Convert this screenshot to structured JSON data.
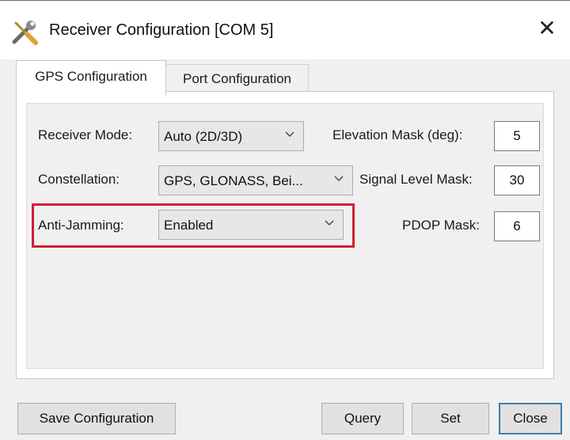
{
  "window": {
    "title": "Receiver Configuration [COM 5]",
    "close_glyph": "✕"
  },
  "tabs": [
    {
      "label": "GPS Configuration",
      "active": true
    },
    {
      "label": "Port Configuration",
      "active": false
    }
  ],
  "gps": {
    "receiver_mode": {
      "label": "Receiver Mode:",
      "value": "Auto (2D/3D)"
    },
    "constellation": {
      "label": "Constellation:",
      "value": "GPS, GLONASS, Bei..."
    },
    "anti_jamming": {
      "label": "Anti-Jamming:",
      "value": "Enabled"
    },
    "elevation_mask": {
      "label": "Elevation Mask (deg):",
      "value": "5"
    },
    "signal_level_mask": {
      "label": "Signal Level Mask:",
      "value": "30"
    },
    "pdop_mask": {
      "label": "PDOP Mask:",
      "value": "6"
    }
  },
  "buttons": {
    "save_configuration": "Save Configuration",
    "query": "Query",
    "set": "Set",
    "close": "Close"
  },
  "icons": {
    "title_icon": "tools-icon",
    "dropdown": "chevron-down-icon"
  },
  "colors": {
    "highlight": "#d02030",
    "default_button_border": "#3c7fb1"
  }
}
